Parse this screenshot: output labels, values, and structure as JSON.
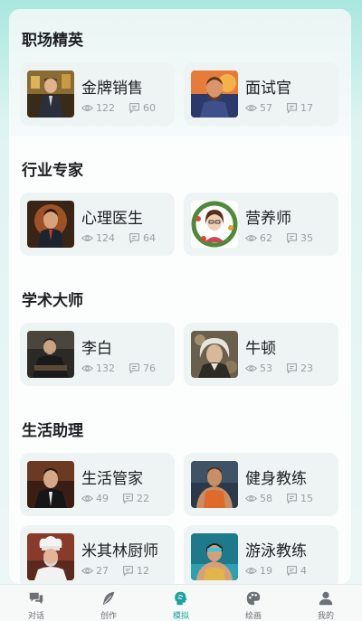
{
  "sections": [
    {
      "title": "职场精英",
      "cards": [
        {
          "name": "金牌销售",
          "views": "122",
          "comments": "60",
          "avatar_icon": "salesman-portrait"
        },
        {
          "name": "面试官",
          "views": "57",
          "comments": "17",
          "avatar_icon": "interviewer-portrait"
        }
      ]
    },
    {
      "title": "行业专家",
      "cards": [
        {
          "name": "心理医生",
          "views": "124",
          "comments": "64",
          "avatar_icon": "psychologist-portrait"
        },
        {
          "name": "营养师",
          "views": "62",
          "comments": "35",
          "avatar_icon": "nutritionist-portrait"
        }
      ]
    },
    {
      "title": "学术大师",
      "cards": [
        {
          "name": "李白",
          "views": "132",
          "comments": "76",
          "avatar_icon": "li-bai-portrait"
        },
        {
          "name": "牛顿",
          "views": "53",
          "comments": "23",
          "avatar_icon": "newton-portrait"
        }
      ]
    },
    {
      "title": "生活助理",
      "cards": [
        {
          "name": "生活管家",
          "views": "49",
          "comments": "22",
          "avatar_icon": "butler-portrait"
        },
        {
          "name": "健身教练",
          "views": "58",
          "comments": "15",
          "avatar_icon": "fitness-coach-portrait"
        },
        {
          "name": "米其林厨师",
          "views": "27",
          "comments": "12",
          "avatar_icon": "chef-portrait"
        },
        {
          "name": "游泳教练",
          "views": "19",
          "comments": "4",
          "avatar_icon": "swim-coach-portrait"
        }
      ]
    }
  ],
  "tabbar": [
    {
      "label": "对话",
      "icon": "chat-icon",
      "active": false
    },
    {
      "label": "创作",
      "icon": "feather-icon",
      "active": false
    },
    {
      "label": "模拟",
      "icon": "head-profile-icon",
      "active": true
    },
    {
      "label": "绘画",
      "icon": "palette-icon",
      "active": false
    },
    {
      "label": "我的",
      "icon": "user-icon",
      "active": false
    }
  ],
  "colors": {
    "accent": "#1aa39a",
    "card_bg": "#eef3f3",
    "stat_gray": "#9aa1a6"
  }
}
